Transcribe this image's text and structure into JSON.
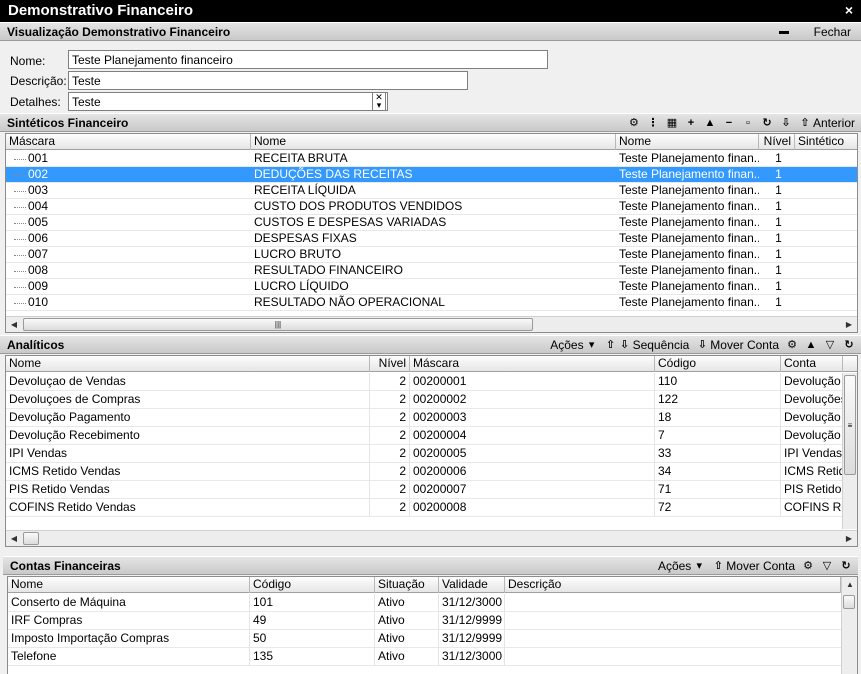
{
  "window": {
    "title": "Demonstrativo Financeiro",
    "close_glyph": "×"
  },
  "visualizacao": {
    "label": "Visualização  Demonstrativo Financeiro",
    "close_label": "Fechar"
  },
  "form": {
    "nome_label": "Nome:",
    "nome_value": "Teste Planejamento financeiro",
    "descricao_label": "Descrição:",
    "descricao_value": "Teste",
    "detalhes_label": "Detalhes:",
    "detalhes_value": "Teste"
  },
  "sinteticos": {
    "label": "Sintéticos Financeiro",
    "anterior_label": "Anterior",
    "columns": [
      "Máscara",
      "Nome",
      "Nome",
      "Nível",
      "Sintético"
    ],
    "rows": [
      {
        "mascara": "001",
        "nome": "RECEITA BRUTA",
        "nome2": "Teste Planejamento finan...",
        "nivel": "1",
        "selected": false
      },
      {
        "mascara": "002",
        "nome": "DEDUÇÕES DAS RECEITAS",
        "nome2": "Teste Planejamento finan...",
        "nivel": "1",
        "selected": true
      },
      {
        "mascara": "003",
        "nome": "RECEITA LÍQUIDA",
        "nome2": "Teste Planejamento finan...",
        "nivel": "1",
        "selected": false
      },
      {
        "mascara": "004",
        "nome": "CUSTO DOS PRODUTOS VENDIDOS",
        "nome2": "Teste Planejamento finan...",
        "nivel": "1",
        "selected": false
      },
      {
        "mascara": "005",
        "nome": "CUSTOS E DESPESAS VARIADAS",
        "nome2": "Teste Planejamento finan...",
        "nivel": "1",
        "selected": false
      },
      {
        "mascara": "006",
        "nome": "DESPESAS FIXAS",
        "nome2": "Teste Planejamento finan...",
        "nivel": "1",
        "selected": false
      },
      {
        "mascara": "007",
        "nome": "LUCRO BRUTO",
        "nome2": "Teste Planejamento finan...",
        "nivel": "1",
        "selected": false
      },
      {
        "mascara": "008",
        "nome": "RESULTADO FINANCEIRO",
        "nome2": "Teste Planejamento finan...",
        "nivel": "1",
        "selected": false
      },
      {
        "mascara": "009",
        "nome": "LUCRO LÍQUIDO",
        "nome2": "Teste Planejamento finan...",
        "nivel": "1",
        "selected": false
      },
      {
        "mascara": "010",
        "nome": "RESULTADO NÃO OPERACIONAL",
        "nome2": "Teste Planejamento finan...",
        "nivel": "1",
        "selected": false
      }
    ]
  },
  "analiticos": {
    "label": "Analíticos",
    "acoes_label": "Ações",
    "sequencia_label": "Sequência",
    "mover_label": "Mover Conta",
    "columns": [
      "Nome",
      "Nível",
      "Máscara",
      "Código",
      "Conta"
    ],
    "rows": [
      {
        "nome": "Devoluçao de Vendas",
        "nivel": "2",
        "mascara": "00200001",
        "codigo": "110",
        "conta": "Devolução d"
      },
      {
        "nome": "Devoluçoes de Compras",
        "nivel": "2",
        "mascara": "00200002",
        "codigo": "122",
        "conta": "Devoluções"
      },
      {
        "nome": "Devolução Pagamento",
        "nivel": "2",
        "mascara": "00200003",
        "codigo": "18",
        "conta": "Devolução P"
      },
      {
        "nome": "Devolução Recebimento",
        "nivel": "2",
        "mascara": "00200004",
        "codigo": "7",
        "conta": "Devolução R"
      },
      {
        "nome": "IPI Vendas",
        "nivel": "2",
        "mascara": "00200005",
        "codigo": "33",
        "conta": "IPI Vendas"
      },
      {
        "nome": "ICMS Retido Vendas",
        "nivel": "2",
        "mascara": "00200006",
        "codigo": "34",
        "conta": "ICMS Retido"
      },
      {
        "nome": "PIS Retido Vendas",
        "nivel": "2",
        "mascara": "00200007",
        "codigo": "71",
        "conta": "PIS Retido V"
      },
      {
        "nome": "COFINS Retido Vendas",
        "nivel": "2",
        "mascara": "00200008",
        "codigo": "72",
        "conta": "COFINS Re"
      }
    ]
  },
  "contas": {
    "label": "Contas Financeiras",
    "acoes_label": "Ações",
    "mover_label": "Mover Conta",
    "columns": [
      "Nome",
      "Código",
      "Situação",
      "Validade",
      "Descrição"
    ],
    "rows": [
      {
        "nome": "Conserto de Máquina",
        "codigo": "101",
        "situacao": "Ativo",
        "validade": "31/12/3000",
        "descricao": ""
      },
      {
        "nome": "IRF Compras",
        "codigo": "49",
        "situacao": "Ativo",
        "validade": "31/12/9999",
        "descricao": ""
      },
      {
        "nome": "Imposto Importação Compras",
        "codigo": "50",
        "situacao": "Ativo",
        "validade": "31/12/9999",
        "descricao": ""
      },
      {
        "nome": "Telefone",
        "codigo": "135",
        "situacao": "Ativo",
        "validade": "31/12/3000",
        "descricao": ""
      }
    ]
  },
  "colors": {
    "selected_row": "#3399ff",
    "titlebar": "#000000"
  }
}
